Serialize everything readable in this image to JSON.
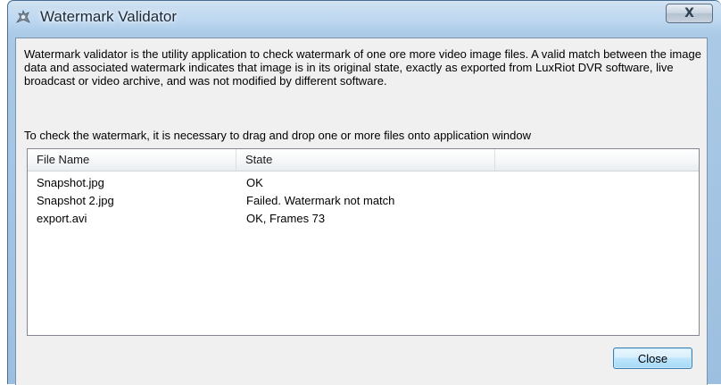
{
  "window": {
    "title": "Watermark Validator",
    "close_glyph": "X"
  },
  "description": "Watermark validator is the utility application to check watermark of one ore more video image files. A valid match between the image data and associated watermark indicates that image is in its original state, exactly as exported from LuxRiot DVR software, live broadcast or video archive, and was not modified by different software.",
  "instruction": "To check the watermark, it is necessary to drag and drop one or more files onto application window",
  "table": {
    "columns": [
      "File Name",
      "State"
    ],
    "rows": [
      {
        "file": "Snapshot.jpg",
        "state": "OK"
      },
      {
        "file": "Snapshot 2.jpg",
        "state": "Failed. Watermark not match"
      },
      {
        "file": "export.avi",
        "state": "OK, Frames 73"
      }
    ]
  },
  "buttons": {
    "close_label": "Close"
  },
  "icons": {
    "app": "app-icon",
    "close": "close-icon"
  },
  "colors": {
    "titlebar": "#a9c9e6",
    "client_bg": "#f0f0f0",
    "button_accent": "#3c7fb1"
  }
}
